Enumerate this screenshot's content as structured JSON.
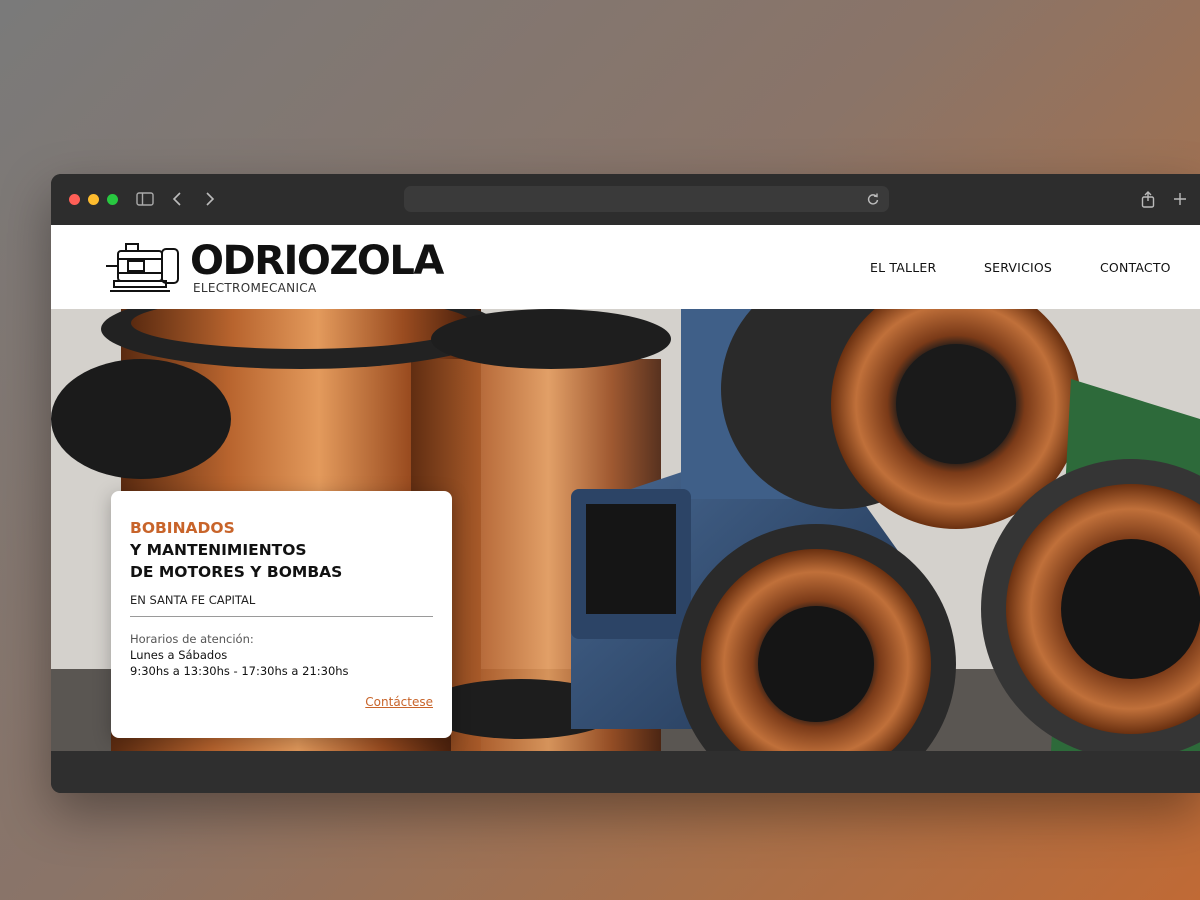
{
  "browser": {
    "address": ""
  },
  "site": {
    "brand": "ODRIOZOLA",
    "brand_sub": "ELECTROMECANICA",
    "nav": [
      "EL TALLER",
      "SERVICIOS",
      "CONTACTO"
    ]
  },
  "card": {
    "headline_accent": "BOBINADOS",
    "headline_line2": "Y MANTENIMIENTOS",
    "headline_line3": "DE MOTORES Y BOMBAS",
    "location": "EN SANTA FE CAPITAL",
    "hours_label": "Horarios de atención:",
    "days": "Lunes a Sábados",
    "hours": "9:30hs a 13:30hs - 17:30hs a 21:30hs",
    "link": "Contáctese"
  },
  "colors": {
    "accent": "#c8642a",
    "chrome": "#2d2d2d"
  }
}
